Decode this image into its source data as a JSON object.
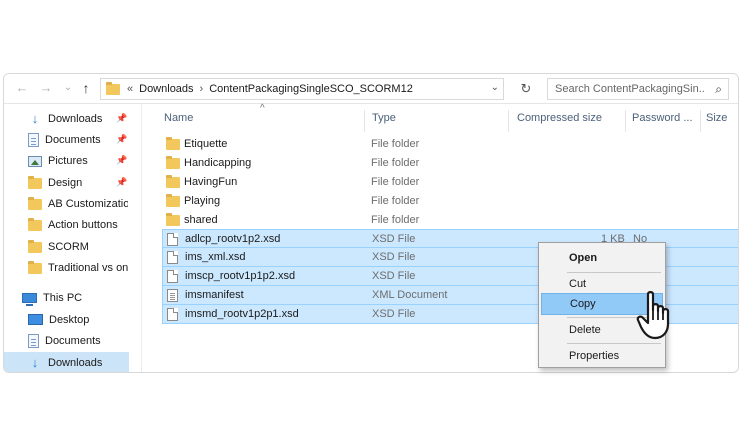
{
  "toolbar": {
    "back_glyph": "←",
    "forward_glyph": "→",
    "recent_glyph": "⌄",
    "up_glyph": "↑",
    "overflow_glyph": "«",
    "separator_glyph": "›",
    "dropdown_glyph": "⌄",
    "refresh_glyph": "↻",
    "search_glyph": "⌕"
  },
  "breadcrumb": {
    "items": [
      "Downloads",
      "ContentPackagingSingleSCO_SCORM12"
    ]
  },
  "search": {
    "placeholder": "Search ContentPackagingSin..."
  },
  "nav": {
    "pin_glyph": "📌",
    "items": [
      {
        "label": "Downloads",
        "icon": "download-arrow-icon",
        "pinned": true
      },
      {
        "label": "Documents",
        "icon": "document-icon",
        "pinned": true
      },
      {
        "label": "Pictures",
        "icon": "picture-icon",
        "pinned": true
      },
      {
        "label": "Design",
        "icon": "folder-icon",
        "pinned": true
      },
      {
        "label": "AB Customization",
        "icon": "folder-icon",
        "pinned": false
      },
      {
        "label": "Action buttons",
        "icon": "folder-icon",
        "pinned": false
      },
      {
        "label": "SCORM",
        "icon": "folder-icon",
        "pinned": false
      },
      {
        "label": "Traditional vs online",
        "icon": "folder-icon",
        "pinned": false
      },
      {
        "label": "This PC",
        "icon": "computer-icon",
        "pinned": false
      },
      {
        "label": "Desktop",
        "icon": "desktop-icon",
        "pinned": false
      },
      {
        "label": "Documents",
        "icon": "document-icon",
        "pinned": false
      },
      {
        "label": "Downloads",
        "icon": "download-arrow-icon",
        "pinned": false,
        "selected": true
      }
    ]
  },
  "columns": {
    "name": "Name",
    "type": "Type",
    "compressed_size": "Compressed size",
    "password": "Password ...",
    "size": "Size",
    "sort_glyph": "^"
  },
  "files": [
    {
      "name": "Etiquette",
      "type": "File folder",
      "size": "",
      "password": "",
      "icon": "folder-icon",
      "selected": false
    },
    {
      "name": "Handicapping",
      "type": "File folder",
      "size": "",
      "password": "",
      "icon": "folder-icon",
      "selected": false
    },
    {
      "name": "HavingFun",
      "type": "File folder",
      "size": "",
      "password": "",
      "icon": "folder-icon",
      "selected": false
    },
    {
      "name": "Playing",
      "type": "File folder",
      "size": "",
      "password": "",
      "icon": "folder-icon",
      "selected": false
    },
    {
      "name": "shared",
      "type": "File folder",
      "size": "",
      "password": "",
      "icon": "folder-icon",
      "selected": false
    },
    {
      "name": "adlcp_rootv1p2.xsd",
      "type": "XSD File",
      "size": "1 KB",
      "password": "No",
      "icon": "xsd-file-icon",
      "selected": true
    },
    {
      "name": "ims_xml.xsd",
      "type": "XSD File",
      "size": "",
      "password": "",
      "icon": "xsd-file-icon",
      "selected": true
    },
    {
      "name": "imscp_rootv1p1p2.xsd",
      "type": "XSD File",
      "size": "",
      "password": "",
      "icon": "xsd-file-icon",
      "selected": true
    },
    {
      "name": "imsmanifest",
      "type": "XML Document",
      "size": "",
      "password": "",
      "icon": "xml-document-icon",
      "selected": true
    },
    {
      "name": "imsmd_rootv1p2p1.xsd",
      "type": "XSD File",
      "size": "",
      "password": "",
      "icon": "xsd-file-icon",
      "selected": true
    }
  ],
  "context_menu": {
    "items": [
      {
        "label": "Open",
        "bold": true,
        "highlighted": false
      },
      {
        "label": "Cut",
        "bold": false,
        "highlighted": false
      },
      {
        "label": "Copy",
        "bold": false,
        "highlighted": true
      },
      {
        "label": "Delete",
        "bold": false,
        "highlighted": false
      },
      {
        "label": "Properties",
        "bold": false,
        "highlighted": false
      }
    ]
  },
  "colors": {
    "selection_bg": "#cce8ff",
    "selection_border": "#99d1ff",
    "menu_highlight": "#91c9f7",
    "folder": "#f2c75c",
    "nav_selected": "#cce4f7"
  }
}
